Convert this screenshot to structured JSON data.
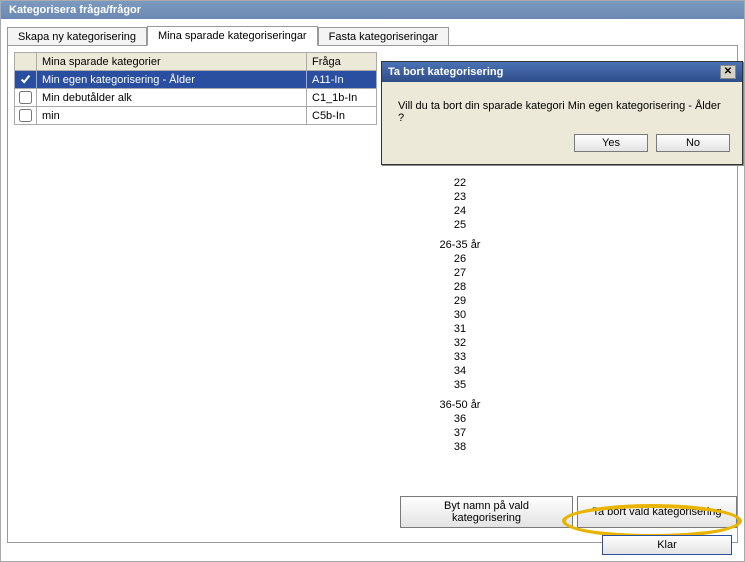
{
  "window": {
    "title": "Kategorisera fråga/frågor"
  },
  "tabs": {
    "new": "Skapa ny kategorisering",
    "saved": "Mina sparade kategoriseringar",
    "fixed": "Fasta kategoriseringar"
  },
  "gridHeaders": {
    "name": "Mina sparade kategorier",
    "question": "Fråga"
  },
  "rows": [
    {
      "name": "Min egen kategorisering - Ålder",
      "question": "A11-In",
      "checked": true,
      "selected": true
    },
    {
      "name": "Min debutålder alk",
      "question": "C1_1b-In",
      "checked": false,
      "selected": false
    },
    {
      "name": "min",
      "question": "C5b-In",
      "checked": false,
      "selected": false
    }
  ],
  "ageGroups": [
    {
      "label": "",
      "values": [
        "22",
        "23",
        "24",
        "25"
      ]
    },
    {
      "label": "26-35  år",
      "values": [
        "26",
        "27",
        "28",
        "29",
        "30",
        "31",
        "32",
        "33",
        "34",
        "35"
      ]
    },
    {
      "label": "36-50 år",
      "values": [
        "36",
        "37",
        "38"
      ]
    }
  ],
  "buttons": {
    "rename": "Byt namn på vald kategorisering",
    "delete": "Ta bort vald kategorisering",
    "done": "Klar"
  },
  "dialog": {
    "title": "Ta bort kategorisering",
    "body": "Vill du ta bort din sparade kategori Min egen kategorisering - Ålder ?",
    "yes": "Yes",
    "no": "No"
  }
}
